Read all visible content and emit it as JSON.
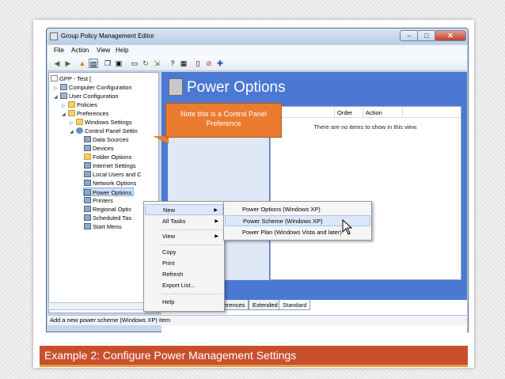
{
  "window": {
    "title": "Group Policy Management Editor",
    "minimize": "–",
    "maximize": "□",
    "close": "✕"
  },
  "menu": [
    "File",
    "Action",
    "View",
    "Help"
  ],
  "toolbar_icons": [
    "back-arrow-icon",
    "forward-arrow-icon",
    "up-folder-icon",
    "show-hide-tree-icon",
    "copy-icon",
    "paste-icon",
    "print-icon",
    "refresh-icon",
    "export-icon",
    "help-icon",
    "properties-icon",
    "stop-icon",
    "add-icon"
  ],
  "tree": {
    "root": "GPP - Test [",
    "items": [
      {
        "label": "Computer Configuration",
        "icon": "computer-icon"
      },
      {
        "label": "User Configuration",
        "icon": "user-config-icon"
      },
      {
        "label": "Policies",
        "icon": "folder-icon"
      },
      {
        "label": "Preferences",
        "icon": "folder-icon"
      },
      {
        "label": "Windows Settings",
        "icon": "folder-icon"
      },
      {
        "label": "Control Panel Settin",
        "icon": "control-panel-icon"
      },
      {
        "label": "Data Sources",
        "icon": "data-sources-icon"
      },
      {
        "label": "Devices",
        "icon": "devices-icon"
      },
      {
        "label": "Folder Options",
        "icon": "folder-options-icon"
      },
      {
        "label": "Internet Settings",
        "icon": "internet-icon"
      },
      {
        "label": "Local Users and C",
        "icon": "users-icon"
      },
      {
        "label": "Network Options",
        "icon": "network-icon"
      },
      {
        "label": "Power Options",
        "icon": "power-icon"
      },
      {
        "label": "Printers",
        "icon": "printer-icon"
      },
      {
        "label": "Regional Optic",
        "icon": "regional-icon"
      },
      {
        "label": "Scheduled Tas",
        "icon": "scheduled-tasks-icon"
      },
      {
        "label": "Start Menu",
        "icon": "start-menu-icon"
      }
    ]
  },
  "content": {
    "title": "Power Options",
    "columns": [
      "Name",
      "Order",
      "Action"
    ],
    "first_col_visible": "e",
    "empty_message": "There are no items to show in this view."
  },
  "callout": {
    "text": "Note this is a Control Panel Preference",
    "color": "#eb7b2f"
  },
  "context_menu": {
    "items": [
      "New",
      "All Tasks",
      "View",
      "Copy",
      "Print",
      "Refresh",
      "Export List...",
      "Help"
    ],
    "highlighted": "New"
  },
  "submenu": {
    "items": [
      "Power Options (Windows XP)",
      "Power Scheme (Windows XP)",
      "Power Plan (Windows Vista and later)"
    ],
    "highlighted": "Power Scheme (Windows XP)"
  },
  "tabs": [
    "Preferences",
    "Extended",
    "Standard"
  ],
  "status_text": "Add a new power scheme (Windows XP) item",
  "caption": "Example 2: Configure Power Management Settings",
  "caption_color": "#c8502c"
}
